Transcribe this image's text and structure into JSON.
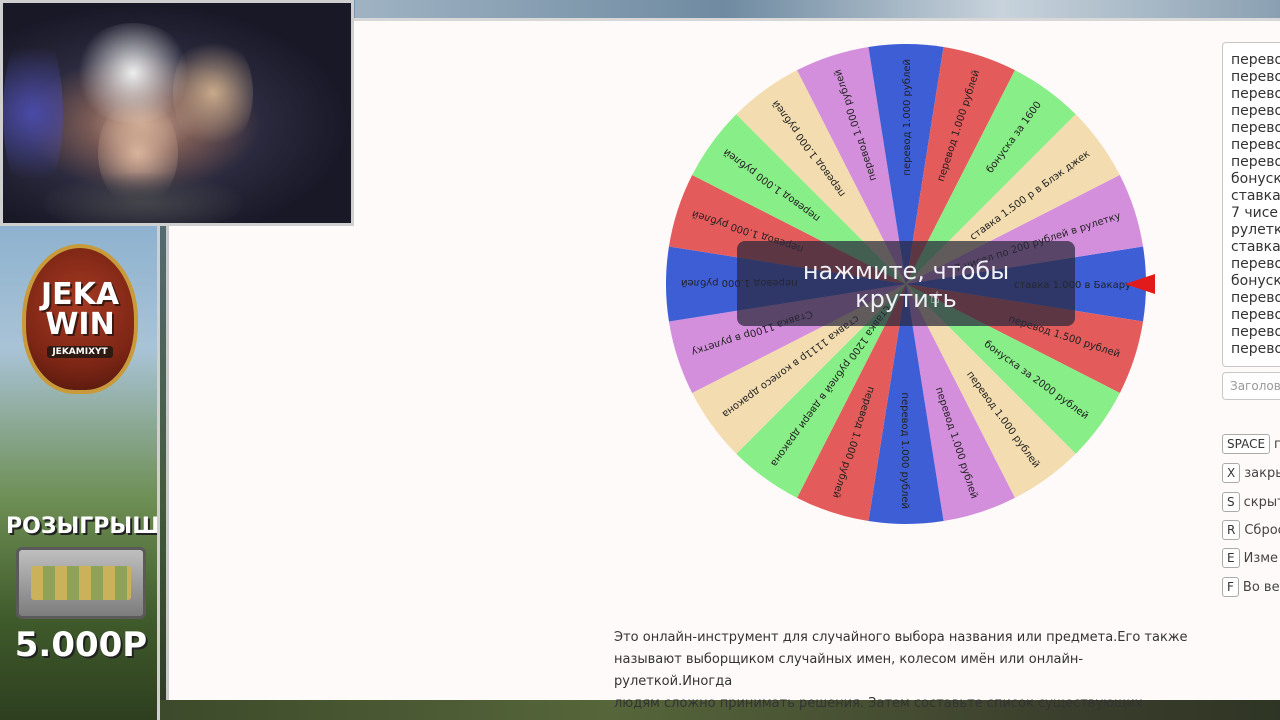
{
  "wheel": {
    "overlay_line1": "нажмите, чтобы",
    "overlay_line2": "крутить",
    "segments": [
      {
        "label": "ставка 1.000 в Бакару",
        "color": "#3e5ed6"
      },
      {
        "label": "перевод 1.500 рублей",
        "color": "#e45b5b"
      },
      {
        "label": "бонуска за 2000 рублей",
        "color": "#88ee88"
      },
      {
        "label": "перевод 1.000 рублей",
        "color": "#f3ddb0"
      },
      {
        "label": "перевод 1.000 рублей",
        "color": "#d48fdc"
      },
      {
        "label": "перевод 1.000 рублей",
        "color": "#3e5ed6"
      },
      {
        "label": "перевод 1.000 рублей",
        "color": "#e45b5b"
      },
      {
        "label": "ставка 1200 рублей в двери дракона",
        "color": "#88ee88"
      },
      {
        "label": "ставка 1111р в колесо дракона",
        "color": "#f3ddb0"
      },
      {
        "label": "Ставка 1100р в рулетку",
        "color": "#d48fdc"
      },
      {
        "label": "перевод 1.000 рублей",
        "color": "#3e5ed6"
      },
      {
        "label": "перевод 1.000 рублей",
        "color": "#e45b5b"
      },
      {
        "label": "перевод 1.000 рублей",
        "color": "#88ee88"
      },
      {
        "label": "перевод 1.000 рублей",
        "color": "#f3ddb0"
      },
      {
        "label": "перевод 1.000 рублей",
        "color": "#d48fdc"
      },
      {
        "label": "перевод 1.000 рублей",
        "color": "#3e5ed6"
      },
      {
        "label": "перевод 1.000 рублей",
        "color": "#e45b5b"
      },
      {
        "label": "бонуска за 1600",
        "color": "#88ee88"
      },
      {
        "label": "ставка 1.500 р в Блэк джек",
        "color": "#f3ddb0"
      },
      {
        "label": "7 чисел по 200 рублей в рулетку",
        "color": "#d48fdc"
      }
    ]
  },
  "entries": [
    "перево",
    "перево",
    "перево",
    "перево",
    "перево",
    "перево",
    "перево",
    "бонуск",
    "ставка",
    "7 чисе",
    "рулетк",
    "ставка",
    "перево",
    "бонуск",
    "перево",
    "перево",
    "перево",
    "перево"
  ],
  "title_placeholder": "Заголово",
  "shortcuts": [
    {
      "key": "SPACE",
      "desc": "п"
    },
    {
      "key": "X",
      "desc": "закры"
    },
    {
      "key": "S",
      "desc": "скрыт"
    },
    {
      "key": "R",
      "desc": "Сброс"
    },
    {
      "key": "E",
      "desc": "Изме"
    },
    {
      "key": "F",
      "desc": "Во ве"
    }
  ],
  "description_lines": [
    "Это онлайн-инструмент для случайного выбора названия или предмета.Его также",
    "называют выборщиком случайных имен, колесом имён или онлайн-рулеткой.Иногда",
    "людям сложно принимать решения. Затем составьте список существующих вариантов"
  ],
  "banner": {
    "logo_line1": "JEKA",
    "logo_line2": "WIN",
    "logo_sub": "JEKAMIXYT",
    "giveaway_title": "РОЗЫГРЫШ",
    "giveaway_amount": "5.000Р"
  }
}
